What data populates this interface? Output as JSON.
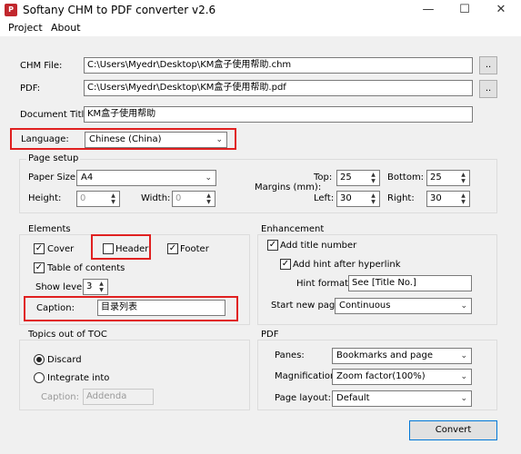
{
  "window": {
    "title": "Softany CHM to PDF converter v2.6",
    "minimize": "—",
    "maximize": "☐",
    "close": "✕"
  },
  "menu": [
    "Project",
    "About"
  ],
  "files": {
    "chm_label": "CHM File:",
    "chm_path": "C:\\Users\\Myedr\\Desktop\\KM盒子使用帮助.chm",
    "pdf_label": "PDF:",
    "pdf_path": "C:\\Users\\Myedr\\Desktop\\KM盒子使用帮助.pdf",
    "browse_label": "..",
    "title_label": "Document Title:",
    "title_value": "KM盒子使用帮助",
    "language_label": "Language:",
    "language_value": "Chinese (China)"
  },
  "page_setup": {
    "title": "Page setup",
    "paper_size_label": "Paper Size:",
    "paper_size_value": "A4",
    "height_label": "Height:",
    "height_value": "0",
    "width_label": "Width:",
    "width_value": "0",
    "margins_label": "Margins (mm):",
    "top_label": "Top:",
    "top_value": "25",
    "bottom_label": "Bottom:",
    "bottom_value": "25",
    "left_label": "Left:",
    "left_value": "30",
    "right_label": "Right:",
    "right_value": "30"
  },
  "elements": {
    "title": "Elements",
    "cover_label": "Cover",
    "cover_checked": true,
    "header_label": "Header",
    "header_checked": false,
    "footer_label": "Footer",
    "footer_checked": true,
    "toc_label": "Table of contents",
    "toc_checked": true,
    "show_level_label": "Show level:",
    "show_level_value": "3",
    "caption_label": "Caption:",
    "caption_value": "目录列表"
  },
  "enhancement": {
    "title": "Enhancement",
    "add_title_number_label": "Add title number",
    "add_hint_label": "Add hint after hyperlink",
    "hint_format_label": "Hint format:",
    "hint_format_value": "See [Title No.]",
    "start_new_page_label": "Start new page:",
    "start_new_page_value": "Continuous"
  },
  "topics": {
    "title": "Topics out of TOC",
    "discard_label": "Discard",
    "integrate_label": "Integrate into",
    "caption_label": "Caption:",
    "caption_value": "Addenda"
  },
  "pdf": {
    "title": "PDF",
    "panes_label": "Panes:",
    "panes_value": "Bookmarks and page",
    "magnification_label": "Magnification:",
    "magnification_value": "Zoom factor(100%)",
    "page_layout_label": "Page layout:",
    "page_layout_value": "Default"
  },
  "convert_label": "Convert",
  "check_mark": "✓",
  "combo_arrow": "⌄",
  "spin_up": "▲",
  "spin_down": "▼",
  "colors": {
    "highlight_red": "#e02020",
    "window_bg": "#f0f0f0",
    "accent_blue": "#0078d7"
  }
}
